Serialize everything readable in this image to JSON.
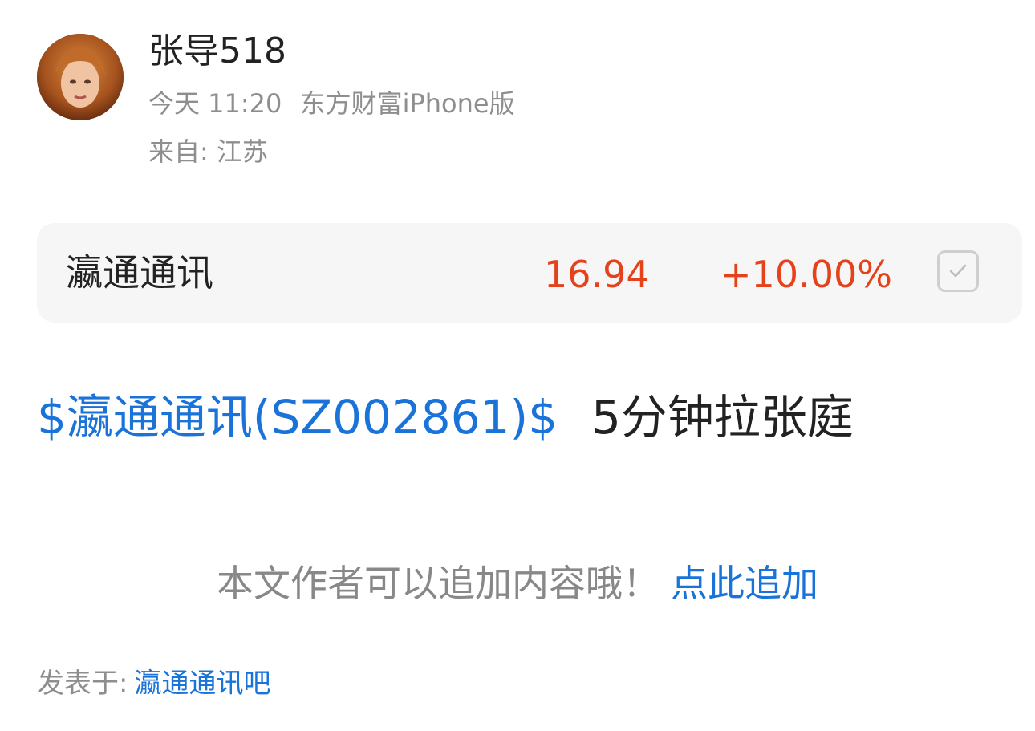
{
  "author": {
    "name": "张导518",
    "time": "今天 11:20",
    "client": "东方财富iPhone版",
    "location": "来自: 江苏"
  },
  "stock_card": {
    "name": "瀛通通讯",
    "price": "16.94",
    "change": "+10.00%",
    "price_color": "#e5421c"
  },
  "post": {
    "stock_tag": "$瀛通通讯(SZ002861)$",
    "text": "5分钟拉张庭"
  },
  "append": {
    "hint": "本文作者可以追加内容哦！",
    "link": "点此追加"
  },
  "footer": {
    "posted_label": "发表于:",
    "forum": "瀛通通讯吧"
  },
  "colors": {
    "accent": "#1a73d9",
    "up": "#e5421c",
    "muted": "#8e8e8e"
  },
  "icons": {
    "avatar": "user-avatar",
    "checkbox": "check-icon"
  }
}
